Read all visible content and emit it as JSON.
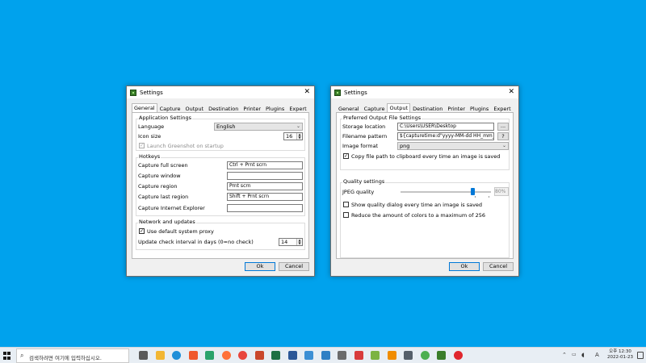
{
  "general": {
    "window_title": "Settings",
    "tabs": [
      {
        "label": "General",
        "active": true
      },
      {
        "label": "Capture",
        "active": false
      },
      {
        "label": "Output",
        "active": false
      },
      {
        "label": "Destination",
        "active": false
      },
      {
        "label": "Printer",
        "active": false
      },
      {
        "label": "Plugins",
        "active": false
      },
      {
        "label": "Expert",
        "active": false
      }
    ],
    "app_settings": {
      "title": "Application Settings",
      "language_label": "Language",
      "language_value": "English",
      "icon_size_label": "Icon size",
      "icon_size_value": "16",
      "launch_label": "Launch Greenshot on startup",
      "launch_checked": true,
      "launch_disabled": true
    },
    "hotkeys": {
      "title": "Hotkeys",
      "items": [
        {
          "label": "Capture full screen",
          "value": "Ctrl + Prnt scrn"
        },
        {
          "label": "Capture window",
          "value": ""
        },
        {
          "label": "Capture region",
          "value": "Prnt scrn"
        },
        {
          "label": "Capture last region",
          "value": "Shift + Prnt scrn"
        },
        {
          "label": "Capture Internet Explorer",
          "value": ""
        }
      ]
    },
    "network": {
      "title": "Network and updates",
      "proxy_label": "Use default system proxy",
      "proxy_checked": true,
      "interval_label": "Update check interval in days (0=no check)",
      "interval_value": "14"
    },
    "ok_label": "Ok",
    "cancel_label": "Cancel"
  },
  "output": {
    "window_title": "Settings",
    "tabs": [
      {
        "label": "General",
        "active": false
      },
      {
        "label": "Capture",
        "active": false
      },
      {
        "label": "Output",
        "active": true
      },
      {
        "label": "Destination",
        "active": false
      },
      {
        "label": "Printer",
        "active": false
      },
      {
        "label": "Plugins",
        "active": false
      },
      {
        "label": "Expert",
        "active": false
      }
    ],
    "preferred": {
      "title": "Preferred Output File Settings",
      "storage_label": "Storage location",
      "storage_value": "C:\\Users\\USER\\Desktop",
      "browse_label": "...",
      "pattern_label": "Filename pattern",
      "pattern_value": "${capturetime:d\"yyyy-MM-dd HH_mm_s",
      "help_label": "?",
      "format_label": "Image format",
      "format_value": "png",
      "copy_label": "Copy file path to clipboard every time an image is saved",
      "copy_checked": true
    },
    "quality": {
      "title": "Quality settings",
      "jpeg_label": "JPEG quality",
      "jpeg_value": 80,
      "jpeg_display": "80%",
      "dialog_label": "Show quality dialog every time an image is saved",
      "dialog_checked": false,
      "reduce_label": "Reduce the amount of colors to a maximum of 256",
      "reduce_checked": false
    },
    "ok_label": "Ok",
    "cancel_label": "Cancel"
  },
  "taskbar": {
    "search_placeholder": "검색하려면 여기에 입력하십시오.",
    "time_line1": "오후 12:30",
    "time_line2": "2022-01-23",
    "ime_label": "A",
    "icons": [
      {
        "name": "task-view-icon",
        "color": "#5a5a5a"
      },
      {
        "name": "file-explorer-icon",
        "color": "#f2b632"
      },
      {
        "name": "edge-icon",
        "color": "#1f8fd8"
      },
      {
        "name": "brave-icon",
        "color": "#f0582b"
      },
      {
        "name": "edge-dev-icon",
        "color": "#2aa36b"
      },
      {
        "name": "firefox-icon",
        "color": "#ff7139"
      },
      {
        "name": "chrome-icon",
        "color": "#e8453c"
      },
      {
        "name": "powerpoint-icon",
        "color": "#c9472b"
      },
      {
        "name": "excel-icon",
        "color": "#1d7044"
      },
      {
        "name": "word-icon",
        "color": "#2b5797"
      },
      {
        "name": "remote-desktop-icon",
        "color": "#3c8fd4"
      },
      {
        "name": "photos-icon",
        "color": "#2f7fc4"
      },
      {
        "name": "snipping-icon",
        "color": "#6b6b6b"
      },
      {
        "name": "app-sc-icon",
        "color": "#d83b3b"
      },
      {
        "name": "android-icon",
        "color": "#7cb342"
      },
      {
        "name": "vlc-icon",
        "color": "#f08c00"
      },
      {
        "name": "calculator-icon",
        "color": "#555f6a"
      },
      {
        "name": "chrome-2-icon",
        "color": "#4caf50"
      },
      {
        "name": "greenshot-icon",
        "color": "#3a7d2a"
      },
      {
        "name": "opera-icon",
        "color": "#e0262d"
      }
    ]
  }
}
